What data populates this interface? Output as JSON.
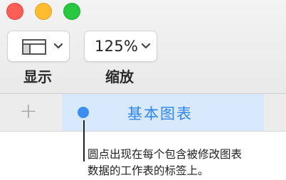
{
  "window": {
    "controls": [
      "close",
      "minimize",
      "zoom"
    ],
    "colors": {
      "close": "#fd5f57",
      "minimize": "#febc2e",
      "zoom": "#28c840"
    }
  },
  "toolbar": {
    "view_button": {
      "icon": "sidebar-layout-icon",
      "label": "显示"
    },
    "zoom_button": {
      "value": "125%",
      "label": "缩放"
    }
  },
  "tabs": {
    "add_icon": "plus-icon",
    "active_tab": {
      "label": "基本图表",
      "indicator": "blue-dot",
      "color": "#3b8ff0"
    }
  },
  "callout": {
    "lines": [
      "圆点出现在每个包含被修改图表",
      "数据的工作表的标签上。"
    ]
  }
}
